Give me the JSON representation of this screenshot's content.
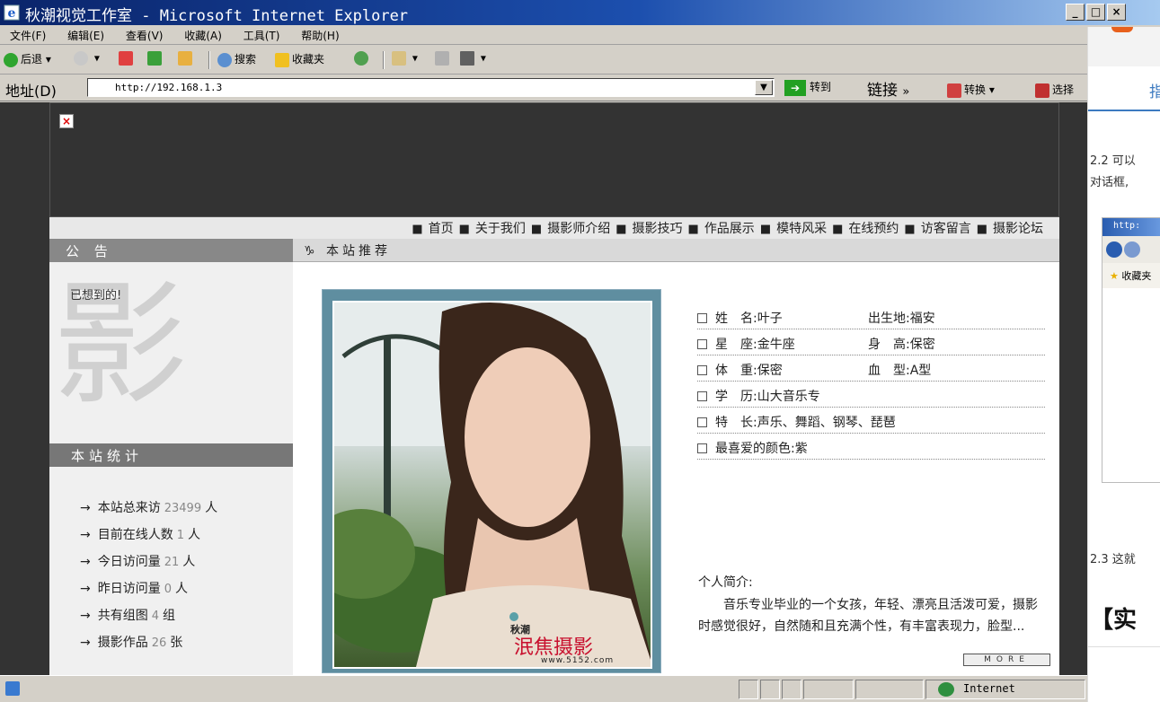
{
  "window": {
    "title": "秋潮视觉工作室 - Microsoft Internet Explorer",
    "controls": [
      "_",
      "□",
      "×"
    ]
  },
  "menubar": [
    "文件(F)",
    "编辑(E)",
    "查看(V)",
    "收藏(A)",
    "工具(T)",
    "帮助(H)"
  ],
  "toolbar": {
    "back": "后退",
    "search": "搜索",
    "favorites": "收藏夹"
  },
  "addressbar": {
    "label": "地址(D)",
    "url": "http://192.168.1.3",
    "go": "转到",
    "links": "链接",
    "chevron": "»",
    "convert": "转换",
    "select": "选择"
  },
  "site": {
    "nav": [
      "首页",
      "关于我们",
      "摄影师介绍",
      "摄影技巧",
      "作品展示",
      "模特风采",
      "在线预约",
      "访客留言",
      "摄影论坛"
    ],
    "sidebar": {
      "notice_title": "公 告",
      "notice_text": "已想到的!",
      "watermark": "影",
      "stats_title": "本站统计",
      "stats": [
        {
          "label": "本站总来访",
          "value": "23499",
          "unit": "人"
        },
        {
          "label": "目前在线人数",
          "value": "1",
          "unit": "人"
        },
        {
          "label": "今日访问量",
          "value": "21",
          "unit": "人"
        },
        {
          "label": "昨日访问量",
          "value": "0",
          "unit": "人"
        },
        {
          "label": "共有组图",
          "value": "4",
          "unit": "组"
        },
        {
          "label": "摄影作品",
          "value": "26",
          "unit": "张"
        }
      ]
    },
    "main": {
      "section_title": "本站推荐",
      "section_icon": "♑",
      "photo_caption_small": "秋潮",
      "photo_caption_big": "泯焦摄影",
      "photo_caption_url": "www.5152.com",
      "profile": [
        {
          "a": "姓　名:叶子",
          "b": "出生地:福安"
        },
        {
          "a": "星　座:金牛座",
          "b": "身　高:保密"
        },
        {
          "a": "体　重:保密",
          "b": "血　型:A型"
        },
        {
          "a": "学　历:山大音乐专",
          "b": ""
        },
        {
          "a": "特　长:声乐、舞蹈、钢琴、琵琶",
          "b": ""
        },
        {
          "a": "最喜爱的颜色:紫",
          "b": ""
        }
      ],
      "intro_title": "个人简介:",
      "intro_text": "音乐专业毕业的一个女孩，年轻、漂亮且活泼可爱，摄影时感觉很好，自然随和且充满个性，有丰富表现力，脸型...",
      "more": "MORE"
    }
  },
  "statusbar": {
    "zone": "Internet"
  },
  "right_panel": {
    "link": "指",
    "text1": "2.2 可以",
    "text2": "对话框,",
    "img_title": "http:",
    "img_fav": "收藏夹",
    "text3": "2.3 这就",
    "heading": "【实"
  },
  "colors": {
    "title_gradient_start": "#0a246a",
    "chrome": "#d4d0c8",
    "site_dark": "#333333",
    "link_blue": "#3c7ac0"
  }
}
